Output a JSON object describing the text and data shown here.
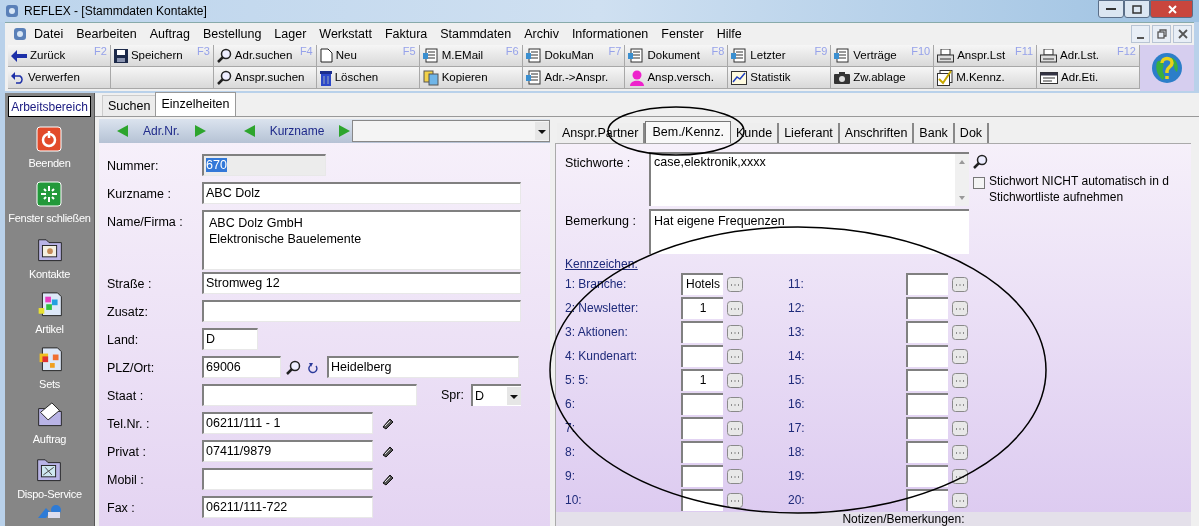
{
  "window": {
    "title": "REFLEX - [Stammdaten Kontakte]"
  },
  "menu": [
    "Datei",
    "Bearbeiten",
    "Auftrag",
    "Bestellung",
    "Lager",
    "Werkstatt",
    "Faktura",
    "Stammdaten",
    "Archiv",
    "Informationen",
    "Fenster",
    "Hilfe"
  ],
  "toolbar": {
    "rows": [
      [
        {
          "label": "Zurück",
          "key": "F2"
        },
        {
          "label": "Speichern",
          "key": "F3"
        },
        {
          "label": "Adr.suchen",
          "key": "F4"
        },
        {
          "label": "Neu",
          "key": "F5"
        },
        {
          "label": "M.EMail",
          "key": "F6"
        },
        {
          "label": "DokuMan",
          "key": "F7"
        },
        {
          "label": "Dokument",
          "key": "F8"
        },
        {
          "label": "Letzter",
          "key": "F9"
        },
        {
          "label": "Verträge",
          "key": "F10"
        },
        {
          "label": "Anspr.Lst",
          "key": "F11"
        },
        {
          "label": "Adr.Lst.",
          "key": "F12"
        }
      ],
      [
        {
          "label": "Verwerfen"
        },
        {},
        {
          "label": "Anspr.suchen"
        },
        {
          "label": "Löschen"
        },
        {
          "label": "Kopieren"
        },
        {
          "label": "Adr.->Anspr."
        },
        {
          "label": "Ansp.versch."
        },
        {
          "label": "Statistik"
        },
        {
          "label": "Zw.ablage"
        },
        {
          "label": "M.Kennz."
        },
        {
          "label": "Adr.Eti."
        }
      ]
    ]
  },
  "sidebar": {
    "title": "Arbeitsbereich",
    "items": [
      "Beenden",
      "Fenster schließen",
      "Kontakte",
      "Artikel",
      "Sets",
      "Auftrag",
      "Dispo-Service"
    ]
  },
  "main_tabs": [
    {
      "label": "Suchen",
      "selected": false
    },
    {
      "label": "Einzelheiten",
      "selected": true
    }
  ],
  "record_nav": [
    "Adr.Nr.",
    "Kurzname"
  ],
  "form": [
    {
      "kind": "readonly",
      "label": "Nummer:",
      "value": "670",
      "selected": true
    },
    {
      "kind": "text",
      "label": "Kurzname :",
      "value": "ABC Dolz"
    },
    {
      "kind": "multiline",
      "label": "Name/Firma :",
      "value": "ABC Dolz GmbH\nElektronische Bauelemente"
    },
    {
      "kind": "text",
      "label": "Straße :",
      "value": "Stromweg 12"
    },
    {
      "kind": "text",
      "label": "Zusatz:"
    },
    {
      "kind": "short",
      "label": "Land:",
      "value": "D"
    },
    {
      "kind": "plz",
      "label": "PLZ/Ort:",
      "value": "69006",
      "city": "Heidelberg"
    },
    {
      "kind": "staat",
      "label": "Staat :",
      "lang_label": "Spr:",
      "lang": "D"
    },
    {
      "kind": "phone",
      "label": "Tel.Nr. :",
      "value": "06211/111 - 1"
    },
    {
      "kind": "phone",
      "label": "Privat :",
      "value": "07411/9879"
    },
    {
      "kind": "phone",
      "label": "Mobil :"
    },
    {
      "kind": "medium",
      "label": "Fax :",
      "value": "06211/111-722"
    }
  ],
  "detail_tabs": [
    {
      "label": "Anspr.Partner",
      "selected": false
    },
    {
      "label": "Bem./Kennz.",
      "selected": true
    },
    {
      "label": "Kunde",
      "selected": false
    },
    {
      "label": "Lieferant",
      "selected": false
    },
    {
      "label": "Anschriften",
      "selected": false
    },
    {
      "label": "Bank",
      "selected": false
    },
    {
      "label": "Dok",
      "selected": false
    }
  ],
  "keywords": {
    "label": "Stichworte :",
    "value": "case,elektronik,xxxx"
  },
  "exclude_option": {
    "lines": [
      "Stichwort NICHT automatisch in d",
      "Stichwortliste aufnehmen"
    ],
    "checked": false
  },
  "remark": {
    "label": "Bemerkung :",
    "value": "Hat eigene Frequenzen"
  },
  "flags": {
    "title": "Kennzeichen:",
    "items": [
      {
        "label": "1: Branche:",
        "value": "Hotels"
      },
      {
        "label": "2: Newsletter:",
        "value": "1"
      },
      {
        "label": "3: Aktionen:"
      },
      {
        "label": "4: Kundenart:"
      },
      {
        "label": "5: 5:",
        "value": "1"
      },
      {
        "label": "6:"
      },
      {
        "label": "7:"
      },
      {
        "label": "8:"
      },
      {
        "label": "9:"
      },
      {
        "label": "10:"
      },
      {
        "label": "11:"
      },
      {
        "label": "12:"
      },
      {
        "label": "13:"
      },
      {
        "label": "14:"
      },
      {
        "label": "15:"
      },
      {
        "label": "16:"
      },
      {
        "label": "17:"
      },
      {
        "label": "18:"
      },
      {
        "label": "19:"
      },
      {
        "label": "20:"
      }
    ]
  },
  "footer": "Notizen/Bemerkungen:"
}
